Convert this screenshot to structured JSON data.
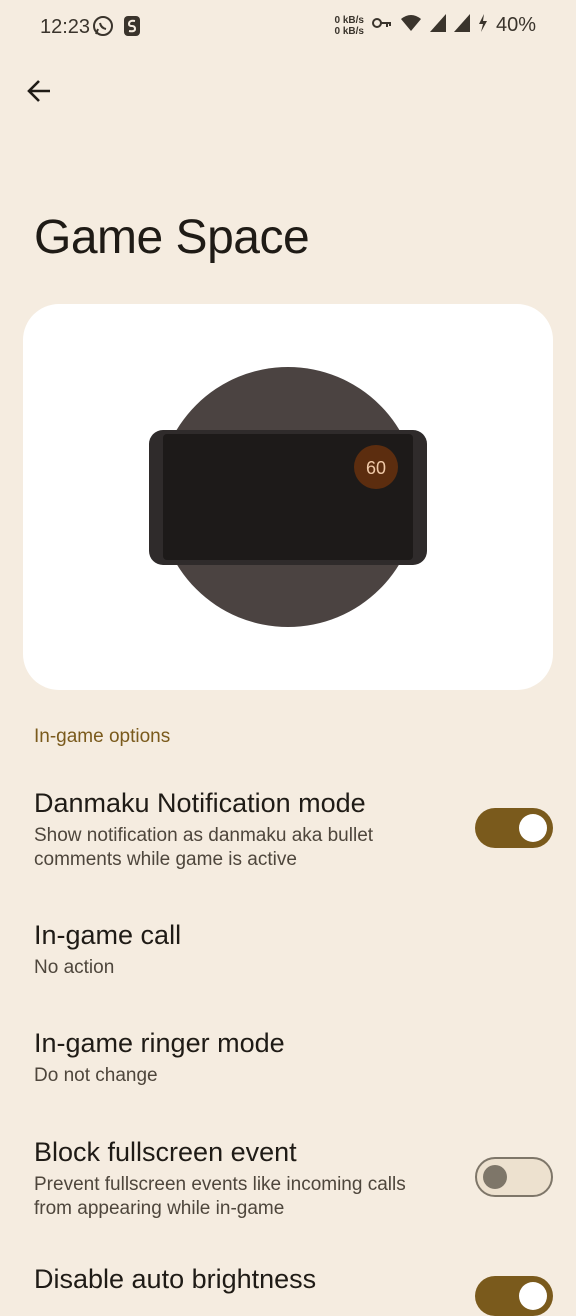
{
  "status_bar": {
    "time": "12:23",
    "net_up": "0 kB/s",
    "net_down": "0 kB/s",
    "battery": "40%",
    "icons": [
      "whatsapp-icon",
      "app-s-icon",
      "vpn-key-icon",
      "wifi-icon",
      "signal-icon",
      "signal-icon",
      "charging-icon"
    ]
  },
  "header": {
    "back_icon": "arrow-back-icon",
    "title": "Game Space"
  },
  "illustration": {
    "fps_badge": "60"
  },
  "section": {
    "header": "In-game options"
  },
  "preferences": [
    {
      "title": "Danmaku Notification mode",
      "summary": "Show notification as danmaku aka bullet comments while game is active",
      "toggle": true
    },
    {
      "title": "In-game call",
      "summary": "No action"
    },
    {
      "title": "In-game ringer mode",
      "summary": "Do not change"
    },
    {
      "title": "Block fullscreen event",
      "summary": "Prevent fullscreen events like incoming calls from appearing while in-game",
      "toggle": false
    },
    {
      "title": "Disable auto brightness",
      "toggle": true
    }
  ],
  "colors": {
    "background": "#f5ece0",
    "accent": "#7a5a1c",
    "card": "#ffffff"
  }
}
